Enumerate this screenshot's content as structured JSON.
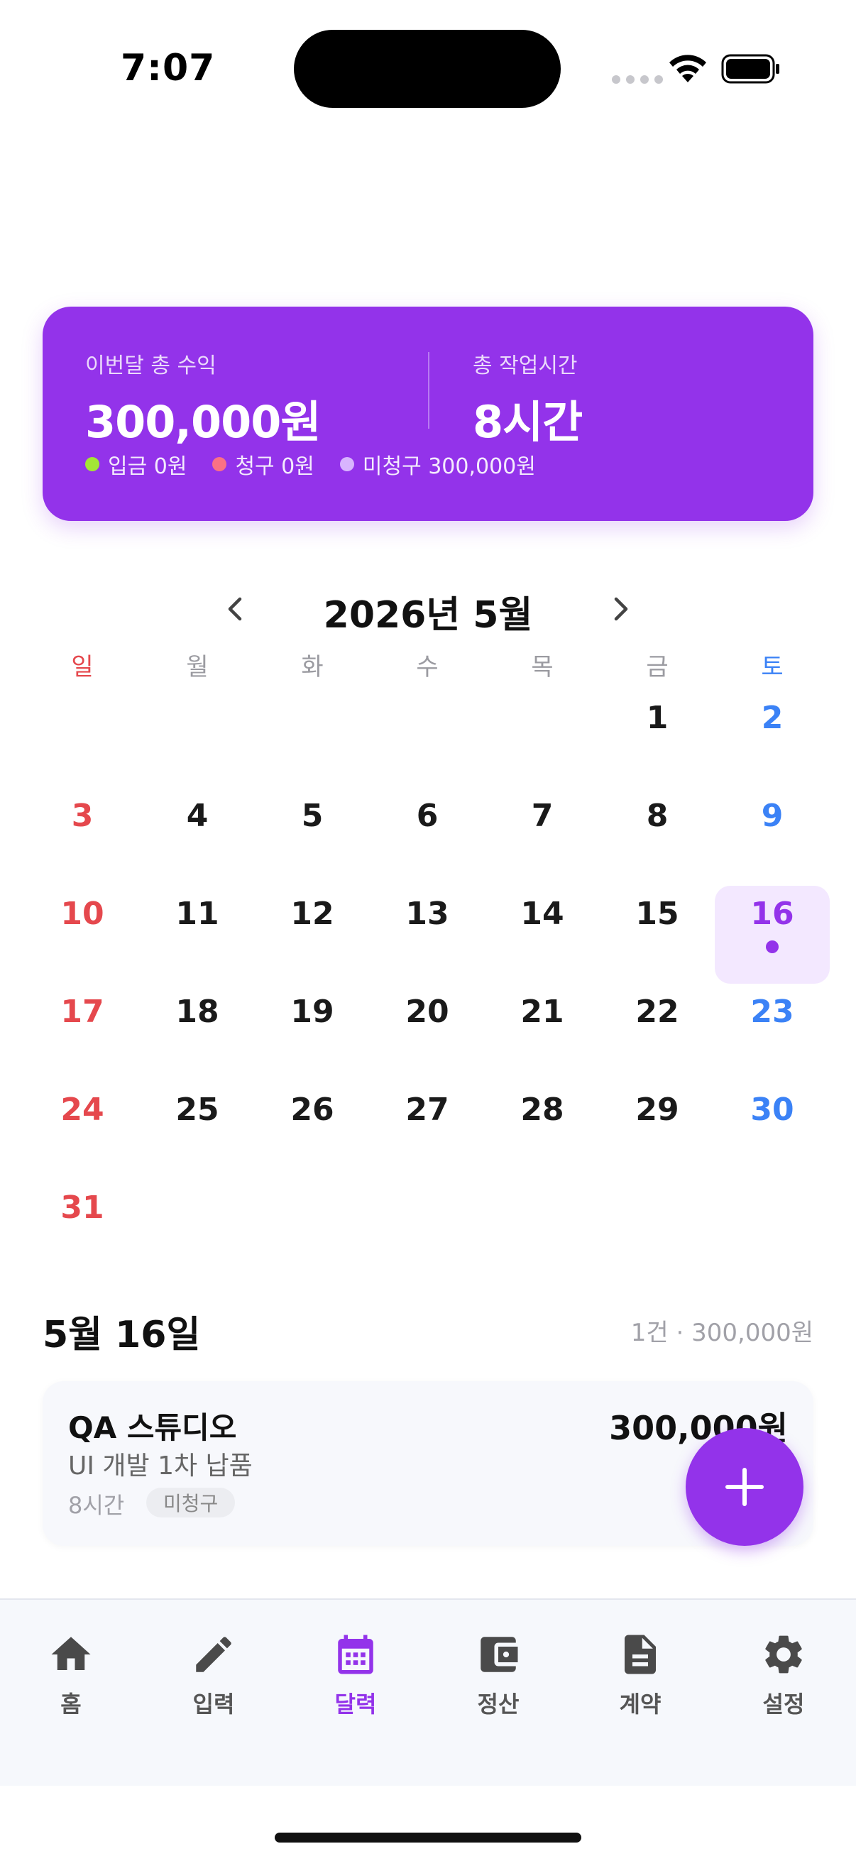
{
  "status_bar": {
    "time": "7:07"
  },
  "summary": {
    "income_label": "이번달 총 수익",
    "income_value": "300,000원",
    "hours_label": "총 작업시간",
    "hours_value": "8시간",
    "legend": [
      {
        "label": "입금 0원",
        "color": "#A3E635"
      },
      {
        "label": "청구 0원",
        "color": "#FB7185"
      },
      {
        "label": "미청구 300,000원",
        "color": "#D8B4FE"
      }
    ]
  },
  "calendar": {
    "title": "2026년 5월",
    "weekdays": [
      "일",
      "월",
      "화",
      "수",
      "목",
      "금",
      "토"
    ],
    "first_weekday_index": 5,
    "days_in_month": 31,
    "selected_day": 16,
    "event_days": [
      16
    ]
  },
  "day_detail": {
    "title": "5월 16일",
    "summary": "1건 · 300,000원",
    "entries": [
      {
        "client": "QA 스튜디오",
        "description": "UI 개발 1차 납품",
        "hours": "8시간",
        "status": "미청구",
        "amount": "300,000원"
      }
    ]
  },
  "tabs": [
    {
      "label": "홈",
      "icon": "home-icon",
      "active": false
    },
    {
      "label": "입력",
      "icon": "pencil-icon",
      "active": false
    },
    {
      "label": "달력",
      "icon": "calendar-icon",
      "active": true
    },
    {
      "label": "정산",
      "icon": "wallet-icon",
      "active": false
    },
    {
      "label": "계약",
      "icon": "document-icon",
      "active": false
    },
    {
      "label": "설정",
      "icon": "gear-icon",
      "active": false
    }
  ],
  "colors": {
    "accent": "#9333EA",
    "sunday": "#E5484D",
    "saturday": "#3B82F6"
  }
}
